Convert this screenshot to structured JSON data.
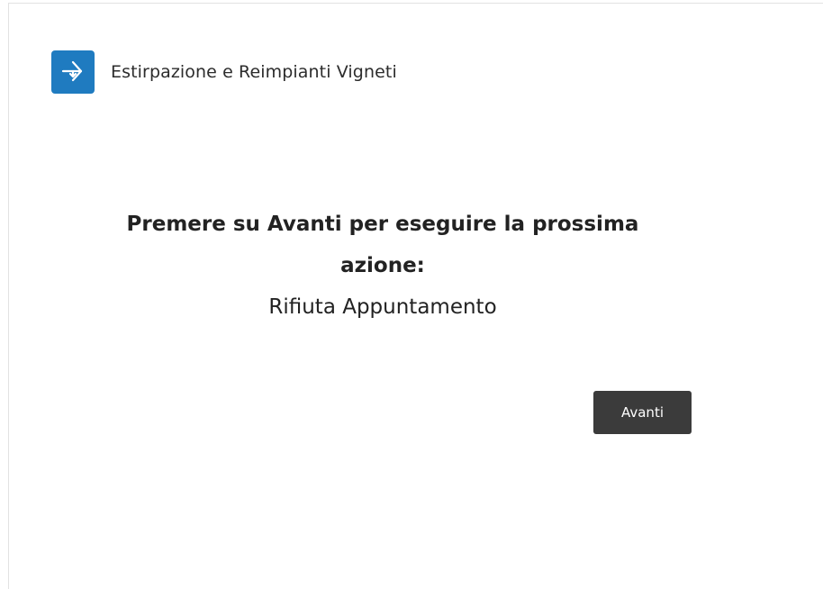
{
  "header": {
    "icon": "workflow-arrows-icon",
    "title": "Estirpazione e Reimpianti Vigneti"
  },
  "main": {
    "prompt": "Premere su Avanti per eseguire la prossima azione:",
    "action": "Rifiuta Appuntamento",
    "next_label": "Avanti"
  },
  "colors": {
    "accent": "#1f7bc0",
    "button_bg": "#3b3b3b"
  }
}
